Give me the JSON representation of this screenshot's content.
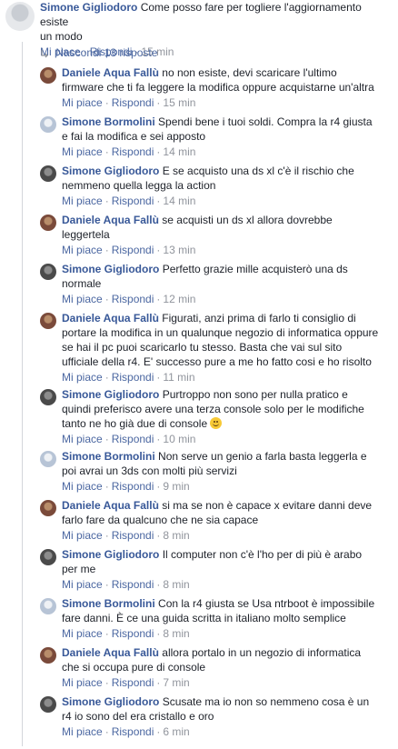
{
  "main": {
    "author": "Simone Gigliodoro",
    "text": "Come posso fare per togliere l'aggiornamento esiste un modo",
    "line2": "un modo",
    "like": "Mi piace",
    "reply": "Rispondi",
    "time": "15 min"
  },
  "toggle": {
    "label": "Nascondi 13 risposte"
  },
  "replies": [
    {
      "author": "Daniele Aqua Fallù",
      "l1": "no non esiste, devi scaricare l'ultimo",
      "l2": "firmware che ti fa leggere la modifica oppure acquistarne un'altra",
      "time": "15 min"
    },
    {
      "author": "Simone Bormolini",
      "l1": "Spendi bene i tuoi soldi. Compra la r4 giusta",
      "l2": "e fai la modifica e sei apposto",
      "time": "14 min"
    },
    {
      "author": "Simone Gigliodoro",
      "l1": "E se acquisto una ds xl c'è il rischio che",
      "l2": "nemmeno quella legga la action",
      "time": "14 min"
    },
    {
      "author": "Daniele Aqua Fallù",
      "l1": "se acquisti un ds xl allora dovrebbe",
      "l2": "leggertela",
      "time": "13 min"
    },
    {
      "author": "Simone Gigliodoro",
      "l1": "Perfetto grazie mille acquisterò una ds",
      "l2": "normale",
      "time": "12 min"
    },
    {
      "author": "Daniele Aqua Fallù",
      "l1": "Figurati, anzi prima di farlo ti consiglio di",
      "l2": "portare la modifica in un qualunque negozio di informatica oppure",
      "l3": "se hai il pc puoi scaricarlo tu stesso. Basta che vai sul sito",
      "l4": "ufficiale della r4. E' successo pure a me ho fatto cosi e ho risolto",
      "time": "11 min"
    },
    {
      "author": "Simone Gigliodoro",
      "l1": "Purtroppo non sono per nulla pratico e",
      "l2": "quindi preferisco avere una terza console solo per le modifiche",
      "l3": "tanto ne ho già due di console",
      "time": "10 min"
    },
    {
      "author": "Simone Bormolini",
      "l1": "Non serve un genio a farla basta leggerla e",
      "l2": "poi avrai un 3ds con molti più servizi",
      "time": "9 min"
    },
    {
      "author": "Daniele Aqua Fallù",
      "l1": "si ma se non è capace x evitare danni deve",
      "l2": "farlo fare da qualcuno che ne sia capace",
      "time": "8 min"
    },
    {
      "author": "Simone Gigliodoro",
      "l1": "Il computer non c'è l'ho per di più è arabo",
      "l2": "per me",
      "time": "8 min"
    },
    {
      "author": "Simone Bormolini",
      "l1": "Con la r4 giusta se Usa ntrboot è impossibile",
      "l2": "fare danni. È ce una guida scritta in italiano molto semplice",
      "time": "8 min"
    },
    {
      "author": "Daniele Aqua Fallù",
      "l1": "allora portalo in un negozio di informatica",
      "l2": "che si occupa pure di console",
      "time": "7 min"
    },
    {
      "author": "Simone Gigliodoro",
      "l1": "Scusate ma io non so nemmeno cosa è un",
      "l2": "r4 io sono del era cristallo e oro",
      "time": "6 min"
    }
  ],
  "labels": {
    "like": "Mi piace",
    "reply": "Rispondi"
  },
  "icons": {
    "emoji": "smiling-face-emoji",
    "chevron": "chevron-right-icon"
  },
  "colors": {
    "link": "#385898",
    "meta": "#90949c",
    "action": "#4b67a1"
  }
}
